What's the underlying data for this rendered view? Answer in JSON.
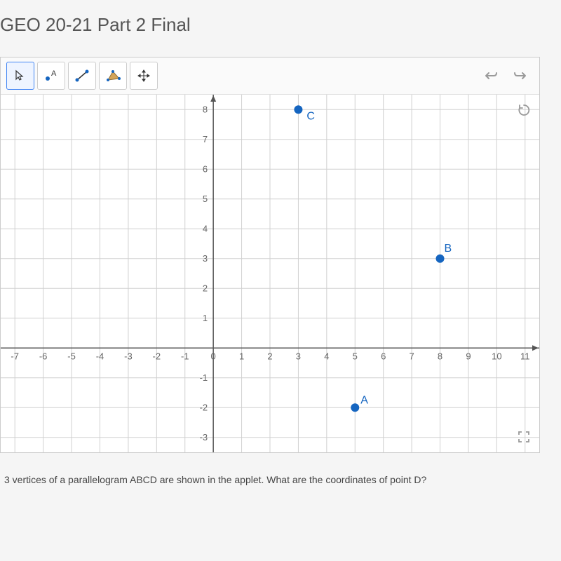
{
  "title": "GEO 20-21 Part 2 Final",
  "toolbar": {
    "tools": [
      "cursor",
      "point-label",
      "segment",
      "polygon",
      "move"
    ],
    "undo_label": "undo",
    "redo_label": "redo",
    "refresh_label": "refresh",
    "fullscreen_label": "fullscreen"
  },
  "question": "3 vertices of a parallelogram ABCD are shown in the applet. What are the coordinates of point D?",
  "chart_data": {
    "type": "scatter",
    "title": "",
    "xlabel": "",
    "ylabel": "",
    "xlim": [
      -7.5,
      11.5
    ],
    "ylim": [
      -3.5,
      8.5
    ],
    "x_ticks": [
      -7,
      -6,
      -5,
      -4,
      -3,
      -2,
      -1,
      0,
      1,
      2,
      3,
      4,
      5,
      6,
      7,
      8,
      9,
      10,
      11
    ],
    "y_ticks": [
      -3,
      -2,
      -1,
      1,
      2,
      3,
      4,
      5,
      6,
      7,
      8
    ],
    "series": [
      {
        "name": "A",
        "x": 5,
        "y": -2
      },
      {
        "name": "B",
        "x": 8,
        "y": 3
      },
      {
        "name": "C",
        "x": 3,
        "y": 8
      }
    ],
    "grid": true
  }
}
